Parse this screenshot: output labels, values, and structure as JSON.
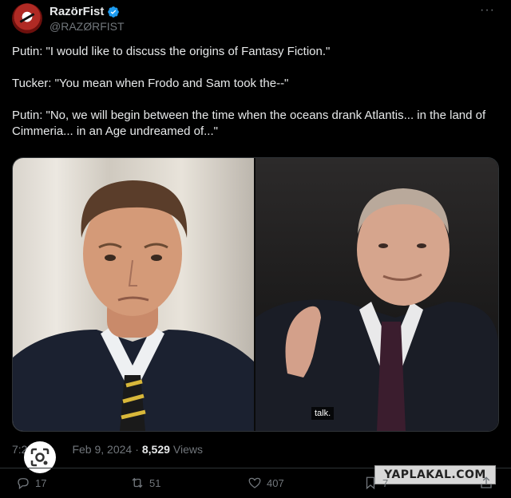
{
  "author": {
    "display_name": "RazörFist",
    "handle": "@RAZØRFIST",
    "verified_color": "#1d9bf0"
  },
  "more_icon": "more-icon",
  "tweet": {
    "lines": [
      "Putin: \"I would like to discuss the origins of Fantasy Fiction.\"",
      "Tucker: \"You mean when Frodo and Sam took the--\"",
      "Putin: \"No, we will begin between the time when the oceans drank Atlantis... in the land of Cimmeria... in an Age undreamed of...\""
    ]
  },
  "media": {
    "caption": "talk."
  },
  "meta": {
    "time": "7:2",
    "date": "Feb 9, 2024",
    "separator": "·",
    "views_count": "8,529",
    "views_label": "Views"
  },
  "actions": {
    "replies": "17",
    "reposts": "51",
    "likes": "407",
    "bookmarks": "7"
  },
  "watermark": "YAPLAKAL.COM",
  "colors": {
    "background": "#000000",
    "text": "#e7e9ea",
    "muted": "#71767b"
  }
}
